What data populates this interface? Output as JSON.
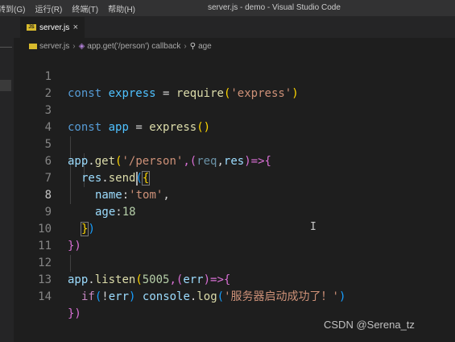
{
  "menu": [
    "转到(G)",
    "运行(R)",
    "终端(T)",
    "帮助(H)"
  ],
  "window_title": "server.js - demo - Visual Studio Code",
  "tab": {
    "badge": "JS",
    "label": "server.js"
  },
  "breadcrumb": {
    "file": "server.js",
    "callback": "app.get('/person') callback",
    "symbol": "age"
  },
  "code": {
    "l1": [
      "const",
      "express",
      "=",
      "require",
      "(",
      "'express'",
      ")"
    ],
    "l3": [
      "const",
      "app",
      "=",
      "express",
      "()"
    ],
    "l5": [
      "app",
      ".",
      "get",
      "(",
      "'/person'",
      ",(",
      "req",
      ",",
      "res",
      ")=>",
      "{"
    ],
    "l6": [
      "res",
      ".",
      "send",
      "(",
      "{"
    ],
    "l7": [
      "name",
      ":",
      "'tom'",
      ","
    ],
    "l8": [
      "age",
      ":",
      "18"
    ],
    "l9": [
      "}",
      ")"
    ],
    "l10": [
      "})"
    ],
    "l12": [
      "app",
      ".",
      "listen",
      "(",
      "5005",
      ",(",
      "err",
      ")=>",
      "{"
    ],
    "l13": [
      "if",
      "(",
      "!",
      "err",
      ")",
      "console",
      ".",
      "log",
      "(",
      "'服务器启动成功了！'",
      ")"
    ],
    "l14": [
      "})"
    ]
  },
  "line_numbers": [
    "1",
    "2",
    "3",
    "4",
    "5",
    "6",
    "7",
    "8",
    "9",
    "10",
    "11",
    "12",
    "13",
    "14"
  ],
  "active_line": "8",
  "watermark": "CSDN @Serena_tz"
}
